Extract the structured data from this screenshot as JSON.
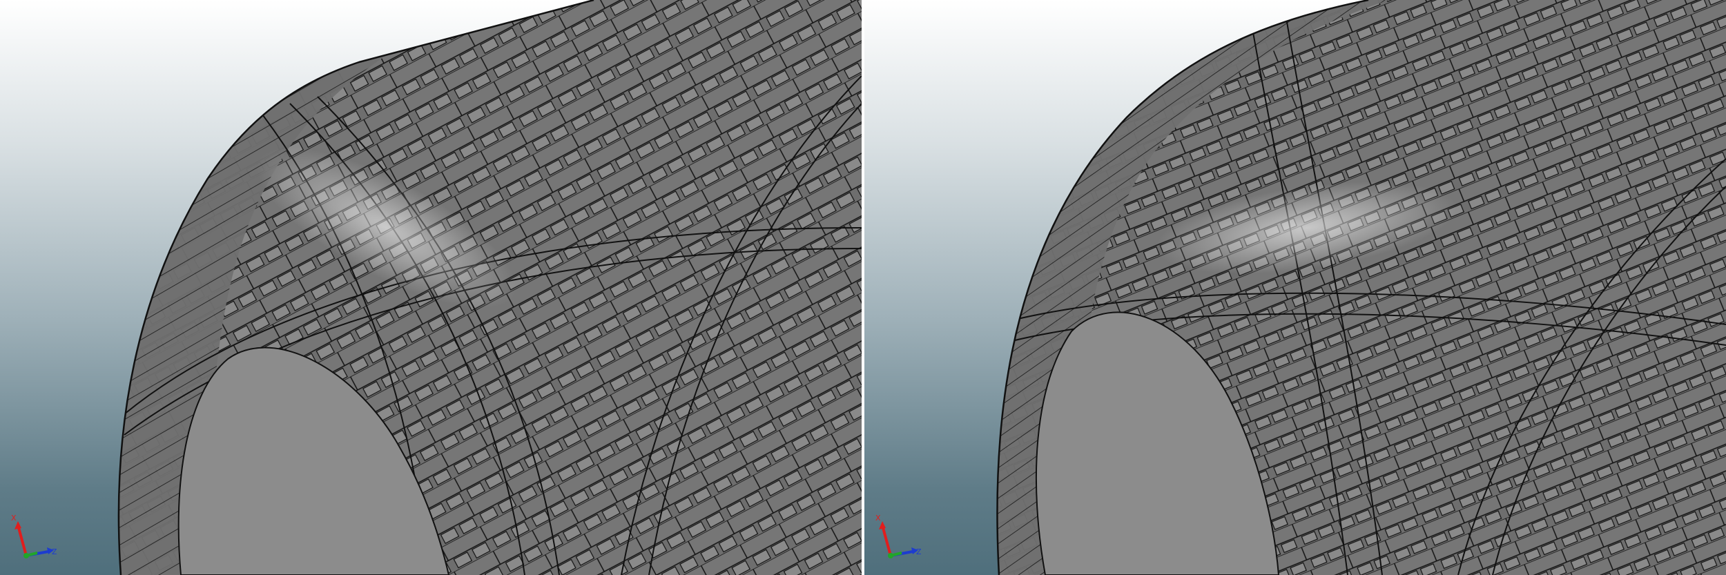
{
  "viewports": [
    {
      "id": "left",
      "triad": {
        "x_label": "X",
        "z_label": "Z"
      }
    },
    {
      "id": "right",
      "triad": {
        "x_label": "X",
        "z_label": "Z"
      }
    }
  ],
  "colors": {
    "background_top": "#ffffff",
    "background_bottom": "#4f6f7c",
    "tow_fill": "#6f6f6f",
    "tow_edge": "#111111",
    "inner_surface": "#8c8c8c",
    "axis_x": "#e11d1d",
    "axis_y": "#22a52a",
    "axis_z": "#1d3ccf"
  }
}
